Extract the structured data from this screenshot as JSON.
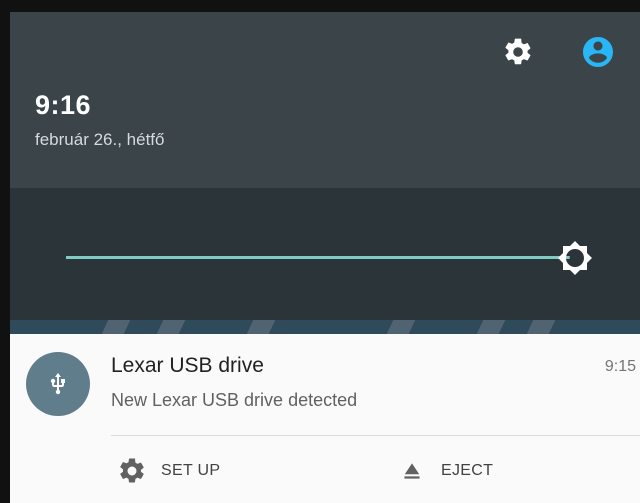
{
  "status_header": {
    "time": "9:16",
    "date": "február 26., hétfő",
    "settings_icon": "gear-icon",
    "account_icon": "account-circle-icon",
    "accent_color": "#29b6f6"
  },
  "brightness": {
    "level": 0.96,
    "track_color": "#80cbc4",
    "icon": "brightness-icon"
  },
  "notification": {
    "icon": "usb-icon",
    "title": "Lexar USB drive",
    "time": "9:15",
    "text": "New Lexar USB drive detected",
    "actions": [
      {
        "label": "SET UP",
        "icon": "gear-icon"
      },
      {
        "label": "EJECT",
        "icon": "eject-icon"
      }
    ]
  }
}
